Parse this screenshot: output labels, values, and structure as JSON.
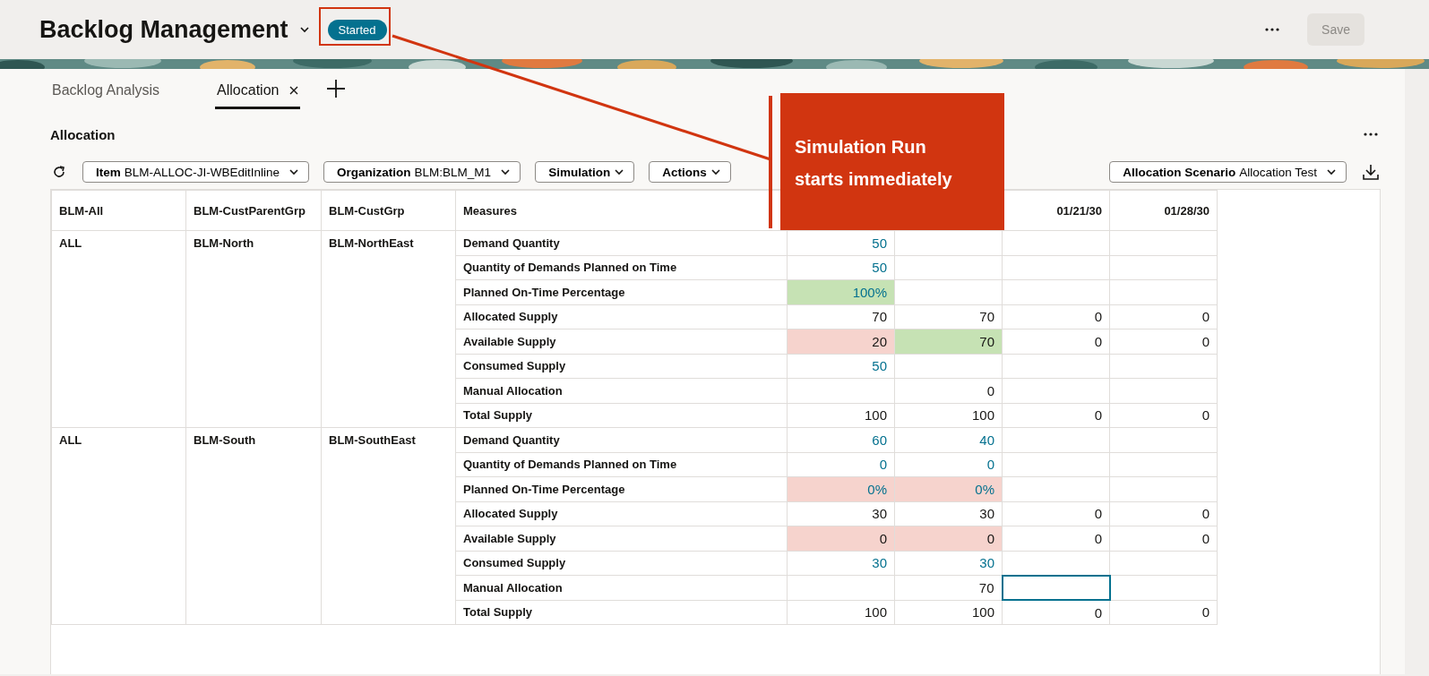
{
  "header": {
    "title": "Backlog Management",
    "status": "Started",
    "save": {
      "label": "Save",
      "disabled": true
    }
  },
  "tabs": [
    {
      "label": "Backlog Analysis",
      "selected": false,
      "closable": false
    },
    {
      "label": "Allocation",
      "selected": true,
      "closable": true
    }
  ],
  "section": {
    "title": "Allocation"
  },
  "filters": [
    {
      "name": "Item",
      "value": "BLM-ALLOC-JI-WBEditInline"
    },
    {
      "name": "Organization",
      "value": "BLM:BLM_M1"
    },
    {
      "name": "Simulation"
    },
    {
      "name": "Actions"
    }
  ],
  "scenario": {
    "name": "Allocation Scenario",
    "value": "Allocation Test"
  },
  "table": {
    "columns": [
      "BLM-All",
      "BLM-CustParentGrp",
      "BLM-CustGrp",
      "Measures"
    ],
    "value_columns": [
      {},
      {},
      {
        "label": "01/21/30"
      },
      {
        "label": "01/28/30"
      }
    ],
    "groups": [
      {
        "all": "ALL",
        "parent": "BLM-North",
        "group": "BLM-NorthEast",
        "rows": [
          {
            "measure": "Demand Quantity",
            "cells": [
              {
                "value": "50",
                "link": true,
                "selected": false
              },
              {
                "selected": false
              },
              {
                "selected": false
              },
              {
                "selected": false
              }
            ]
          },
          {
            "measure": "Quantity of Demands Planned on Time",
            "cells": [
              {
                "value": "50",
                "link": true,
                "selected": false
              },
              {
                "selected": false
              },
              {
                "selected": false
              },
              {
                "selected": false
              }
            ]
          },
          {
            "measure": "Planned On-Time Percentage",
            "cells": [
              {
                "value": "100%",
                "link": true,
                "color": "#c6e2b4",
                "selected": false
              },
              {
                "selected": false
              },
              {
                "selected": false
              },
              {
                "selected": false
              }
            ]
          },
          {
            "measure": "Allocated Supply",
            "cells": [
              {
                "value": "70",
                "selected": false
              },
              {
                "value": "70",
                "selected": false
              },
              {
                "value": "0",
                "selected": false
              },
              {
                "value": "0",
                "selected": false
              }
            ]
          },
          {
            "measure": "Available Supply",
            "cells": [
              {
                "value": "20",
                "color": "#f6d3cd",
                "selected": false
              },
              {
                "value": "70",
                "color": "#c6e2b4",
                "selected": false
              },
              {
                "value": "0",
                "selected": false
              },
              {
                "value": "0",
                "selected": false
              }
            ]
          },
          {
            "measure": "Consumed Supply",
            "cells": [
              {
                "value": "50",
                "link": true,
                "selected": false
              },
              {
                "selected": false
              },
              {
                "selected": false
              },
              {
                "selected": false
              }
            ]
          },
          {
            "measure": "Manual Allocation",
            "cells": [
              {
                "selected": false
              },
              {
                "value": "0",
                "selected": false
              },
              {
                "selected": false
              },
              {
                "selected": false
              }
            ]
          },
          {
            "measure": "Total Supply",
            "cells": [
              {
                "value": "100",
                "selected": false
              },
              {
                "value": "100",
                "selected": false
              },
              {
                "value": "0",
                "selected": false
              },
              {
                "value": "0",
                "selected": false
              }
            ]
          }
        ]
      },
      {
        "all": "ALL",
        "parent": "BLM-South",
        "group": "BLM-SouthEast",
        "rows": [
          {
            "measure": "Demand Quantity",
            "cells": [
              {
                "value": "60",
                "link": true,
                "selected": false
              },
              {
                "value": "40",
                "link": true,
                "selected": false
              },
              {
                "selected": false
              },
              {
                "selected": false
              }
            ]
          },
          {
            "measure": "Quantity of Demands Planned on Time",
            "cells": [
              {
                "value": "0",
                "link": true,
                "selected": false
              },
              {
                "value": "0",
                "link": true,
                "selected": false
              },
              {
                "selected": false
              },
              {
                "selected": false
              }
            ]
          },
          {
            "measure": "Planned On-Time Percentage",
            "cells": [
              {
                "value": "0%",
                "link": true,
                "color": "#f6d3cd",
                "selected": false
              },
              {
                "value": "0%",
                "link": true,
                "color": "#f6d3cd",
                "selected": false
              },
              {
                "selected": false
              },
              {
                "selected": false
              }
            ]
          },
          {
            "measure": "Allocated Supply",
            "cells": [
              {
                "value": "30",
                "selected": false
              },
              {
                "value": "30",
                "selected": false
              },
              {
                "value": "0",
                "selected": false
              },
              {
                "value": "0",
                "selected": false
              }
            ]
          },
          {
            "measure": "Available Supply",
            "cells": [
              {
                "value": "0",
                "color": "#f6d3cd",
                "selected": false
              },
              {
                "value": "0",
                "color": "#f6d3cd",
                "selected": false
              },
              {
                "value": "0",
                "selected": false
              },
              {
                "value": "0",
                "selected": false
              }
            ]
          },
          {
            "measure": "Consumed Supply",
            "cells": [
              {
                "value": "30",
                "link": true,
                "selected": false
              },
              {
                "value": "30",
                "link": true,
                "selected": false
              },
              {
                "selected": false
              },
              {
                "selected": false
              }
            ]
          },
          {
            "measure": "Manual Allocation",
            "cells": [
              {
                "selected": false
              },
              {
                "value": "70",
                "selected": false
              },
              {
                "selected": true
              },
              {
                "selected": false
              }
            ]
          },
          {
            "measure": "Total Supply",
            "cells": [
              {
                "value": "100",
                "selected": false
              },
              {
                "value": "100",
                "selected": false
              },
              {
                "value": "0",
                "selected": false
              },
              {
                "value": "0",
                "selected": false
              }
            ]
          }
        ]
      }
    ]
  },
  "callout": {
    "text": "Simulation Run starts immediately"
  }
}
